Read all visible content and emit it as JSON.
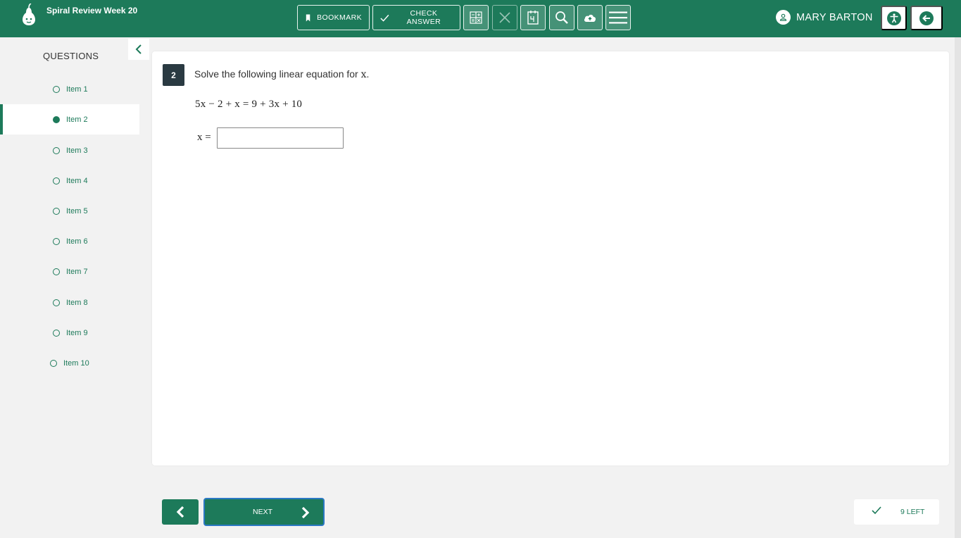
{
  "header": {
    "title": "Spiral Review Week 20",
    "bookmark_label": "BOOKMARK",
    "check_answer_label": "CHECK ANSWER",
    "user_name": "MARY BARTON",
    "brand_color": "#1d7a5a"
  },
  "toolbar_icons": [
    "calculator-icon",
    "close-icon",
    "reference-sheet-icon",
    "magnifier-icon",
    "cloud-upload-icon",
    "menu-icon"
  ],
  "sidebar": {
    "heading": "QUESTIONS",
    "active_index": 1,
    "items": [
      {
        "label": "Item 1"
      },
      {
        "label": "Item 2"
      },
      {
        "label": "Item 3"
      },
      {
        "label": "Item 4"
      },
      {
        "label": "Item 5"
      },
      {
        "label": "Item 6"
      },
      {
        "label": "Item 7"
      },
      {
        "label": "Item 8"
      },
      {
        "label": "Item 9"
      },
      {
        "label": "Item 10"
      }
    ]
  },
  "question": {
    "number": "2",
    "prompt": "Solve the following linear equation for ",
    "prompt_var": "x",
    "prompt_end": ".",
    "equation": "5x − 2 + x = 9 + 3x + 10",
    "answer_label": "x =",
    "answer_value": ""
  },
  "footer": {
    "next_label": "NEXT",
    "remaining_label": "9 LEFT"
  }
}
